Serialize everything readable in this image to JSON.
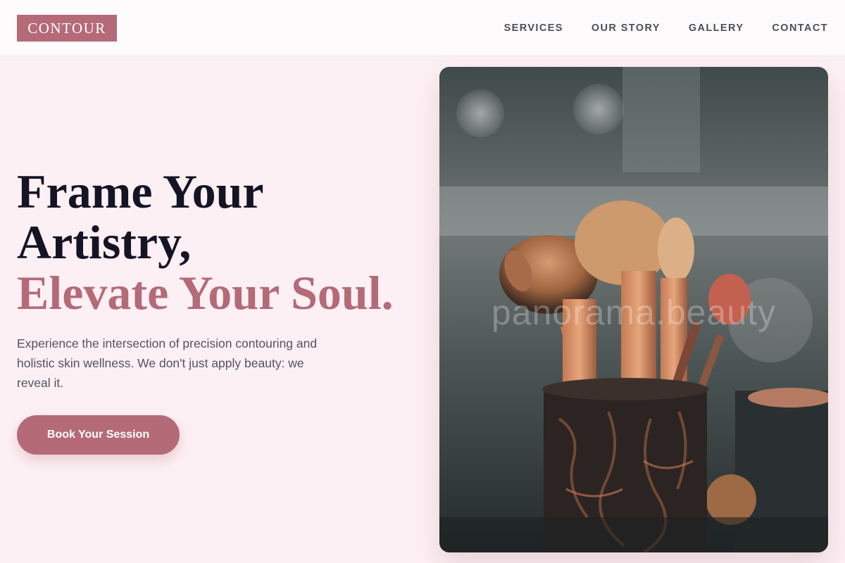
{
  "brand": {
    "logo_text": "CONTOUR",
    "accent_color": "#b56a78"
  },
  "nav": {
    "items": [
      {
        "label": "SERVICES"
      },
      {
        "label": "OUR STORY"
      },
      {
        "label": "GALLERY"
      },
      {
        "label": "CONTACT"
      }
    ]
  },
  "hero": {
    "headline_line1": "Frame Your",
    "headline_line2": "Artistry,",
    "headline_accent": "Elevate Your Soul.",
    "description": "Experience the intersection of precision contouring and holistic skin wellness. We don't just apply beauty: we reveal it.",
    "cta_label": "Book Your Session",
    "image_watermark": "panorama.beauty"
  }
}
